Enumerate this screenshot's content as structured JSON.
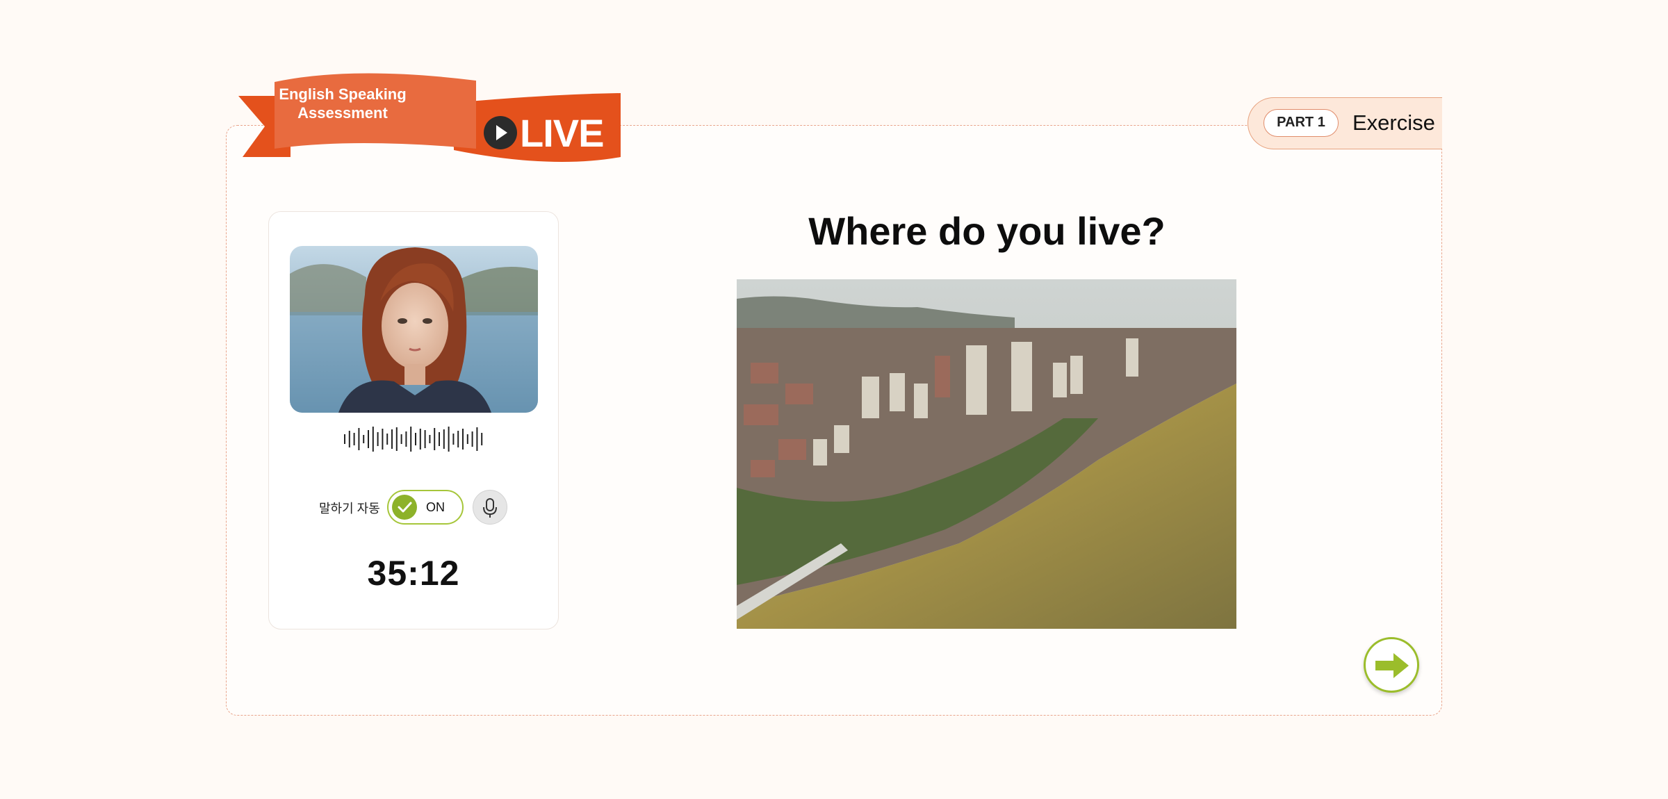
{
  "header": {
    "banner_title": "English Speaking\nAssessment",
    "live_label": "LIVE",
    "part_badge": "PART 1",
    "part_name": "Exercise"
  },
  "speaker_card": {
    "auto_speak_label": "말하기 자동",
    "toggle_state": "ON",
    "timer": "35:12"
  },
  "question": {
    "text": "Where do you live?"
  },
  "icons": [
    "play-icon",
    "waveform-icon",
    "check-icon",
    "microphone-icon",
    "arrow-right-icon"
  ],
  "colors": {
    "accent_orange": "#e4511c",
    "accent_green": "#8db22a",
    "background": "#fffaf6"
  }
}
